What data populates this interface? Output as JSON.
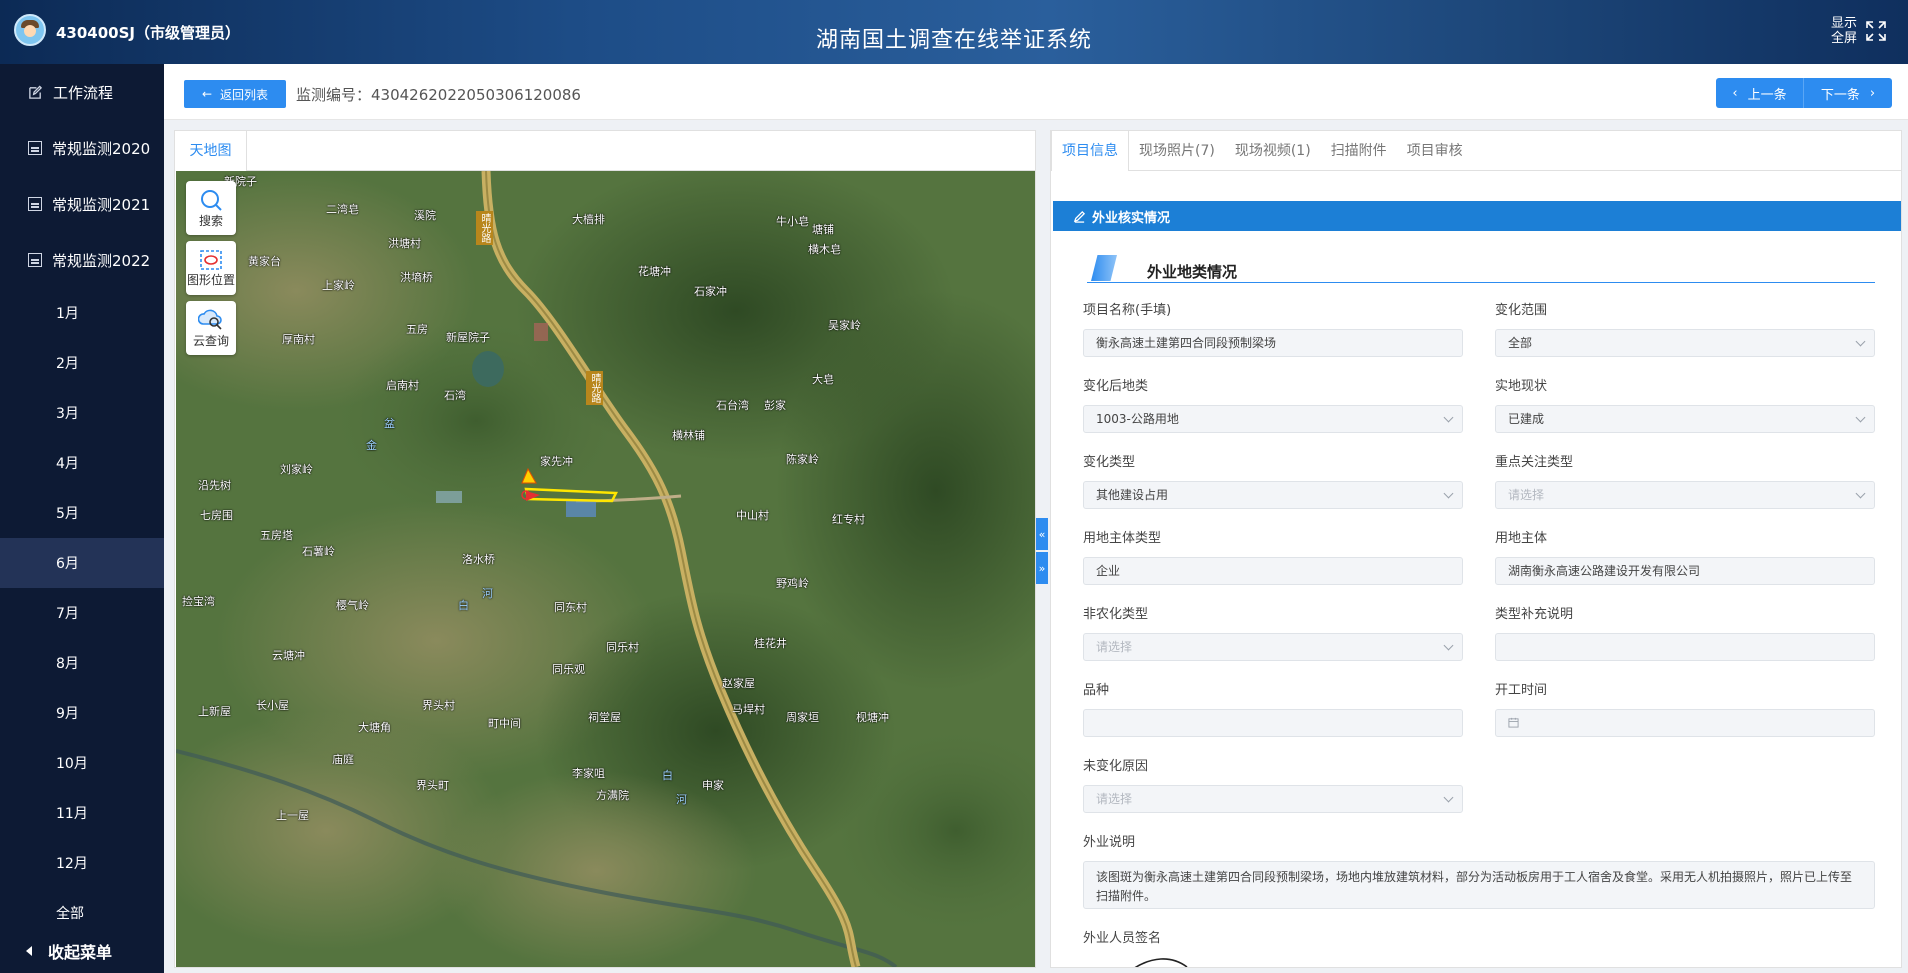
{
  "header": {
    "user": "430400SJ（市级管理员）",
    "title": "湖南国土调查在线举证系统",
    "fullscreen_label": "显示全屏"
  },
  "sidebar": {
    "items": [
      {
        "label": "工作流程"
      },
      {
        "label": "常规监测2020"
      },
      {
        "label": "常规监测2021"
      },
      {
        "label": "常规监测2022"
      }
    ],
    "months": [
      "1月",
      "2月",
      "3月",
      "4月",
      "5月",
      "6月",
      "7月",
      "8月",
      "9月",
      "10月",
      "11月",
      "12月",
      "全部"
    ],
    "active_month": "6月",
    "collapse_label": "收起菜单"
  },
  "topbar": {
    "back_label": "返回列表",
    "monitor_label": "监测编号：430426202205030612008​6",
    "prev_label": "上一条",
    "next_label": "下一条"
  },
  "map": {
    "tab_label": "天地图",
    "tools": [
      {
        "label": "搜索",
        "icon": "search-icon"
      },
      {
        "label": "图形位置",
        "icon": "shape-location-icon"
      },
      {
        "label": "云查询",
        "icon": "cloud-query-icon"
      }
    ],
    "road_label": "晴光路",
    "place_labels": [
      "新院子",
      "二湾皂",
      "溪院",
      "大樯排",
      "牛小皂",
      "塘铺",
      "横木皂",
      "黄家台",
      "洪塘村",
      "上家岭",
      "洪墒桥",
      "花塘冲",
      "石家冲",
      "吴家岭",
      "厚南村",
      "五房",
      "新屋院子",
      "启南村",
      "石湾",
      "大皂",
      "石台湾",
      "彭家",
      "横林铺",
      "陈家岭",
      "刘家岭",
      "家先冲",
      "沿先树",
      "七房围",
      "五房塔",
      "石薯岭",
      "中山村",
      "红专村",
      "洛水桥",
      "野鸡岭",
      "捡宝湾",
      "樱气岭",
      "同东村",
      "同乐村",
      "桂花井",
      "云塘冲",
      "同乐观",
      "上新屋",
      "赵家屋",
      "长小屋",
      "界头村",
      "町中间",
      "祠堂屋",
      "马垾村",
      "周家垣",
      "枧塘冲",
      "大塘角",
      "庙庭",
      "李家咀",
      "界头町",
      "方满院",
      "申家",
      "上一屋"
    ],
    "water_labels": [
      "盆",
      "金",
      "白",
      "河",
      "白",
      "河"
    ]
  },
  "tabs": [
    "项目信息",
    "现场照片(7)",
    "现场视频(1)",
    "扫描附件",
    "项目审核"
  ],
  "form": {
    "section_title": "外业核实情况",
    "subsection_title": "外业地类情况",
    "fields": {
      "project_name": {
        "label": "项目名称(手填)",
        "value": "衡永高速土建第四合同段预制梁场"
      },
      "change_scope": {
        "label": "变化范围",
        "value": "全部"
      },
      "land_after": {
        "label": "变化后地类",
        "value": "1003-公路用地"
      },
      "actual_status": {
        "label": "实地现状",
        "value": "已建成"
      },
      "change_type": {
        "label": "变化类型",
        "value": "其他建设占用"
      },
      "focus_type": {
        "label": "重点关注类型",
        "placeholder": "请选择"
      },
      "owner_type": {
        "label": "用地主体类型",
        "value": "企业"
      },
      "owner": {
        "label": "用地主体",
        "value": "湖南衡永高速公路建设开发有限公司"
      },
      "nonagri_type": {
        "label": "非农化类型",
        "placeholder": "请选择"
      },
      "type_note": {
        "label": "类型补充说明",
        "value": ""
      },
      "variety": {
        "label": "品种",
        "value": ""
      },
      "start_time": {
        "label": "开工时间",
        "value": ""
      },
      "unchanged_reason": {
        "label": "未变化原因",
        "placeholder": "请选择"
      },
      "field_note": {
        "label": "外业说明",
        "value": "该图斑为衡永高速土建第四合同段预制梁场，场地内堆放建筑材料，部分为活动板房用于工人宿舍及食堂。采用无人机拍摄照片，照片已上传至扫描附件。"
      },
      "signature": {
        "label": "外业人员签名"
      }
    }
  }
}
